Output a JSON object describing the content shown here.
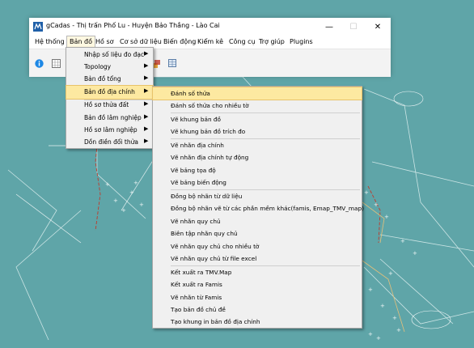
{
  "window": {
    "title": "gCadas - Thị trấn Phố Lu - Huyện Bảo Thắng - Lào Cai",
    "minimize_glyph": "—",
    "maximize_glyph": "☐",
    "close_glyph": "✕"
  },
  "menubar": {
    "items": [
      "Hệ thống",
      "Bản đồ",
      "Hồ sơ",
      "Cơ sở dữ liệu",
      "Biến động",
      "Kiểm kê",
      "Công cụ",
      "Trợ giúp",
      "Plugins"
    ],
    "active": "Bản đồ"
  },
  "toolbar": {
    "icons": [
      "info-icon",
      "grid-icon",
      "map-layers-icon",
      "table-icon"
    ]
  },
  "dropdown": {
    "arrow_glyph": "▶",
    "items": [
      {
        "label": "Nhập số liệu đo đạc",
        "has_submenu": true
      },
      {
        "label": "Topology",
        "has_submenu": true
      },
      {
        "label": "Bản đồ tổng",
        "has_submenu": true
      },
      {
        "label": "Bản đồ địa chính",
        "has_submenu": true,
        "highlighted": true
      },
      {
        "label": "Hồ sơ thửa đất",
        "has_submenu": true
      },
      {
        "label": "Bản đồ lâm nghiệp",
        "has_submenu": true
      },
      {
        "label": "Hồ sơ lâm nghiệp",
        "has_submenu": true
      },
      {
        "label": "Dồn điền đổi thửa",
        "has_submenu": true
      }
    ]
  },
  "submenu": {
    "items": [
      "Đánh số thửa",
      "Đánh số thửa cho nhiều tờ",
      "Vẽ khung bản đồ",
      "Vẽ khung bản đồ trích đo",
      "Vẽ nhãn địa chính",
      "Vẽ nhãn địa chính tự động",
      "Vẽ bảng tọa độ",
      "Vẽ bảng biến động",
      "Đồng bộ nhãn từ dữ liệu",
      "Đồng bộ nhãn vẽ từ các phần mềm khác(famis, Emap_TMV_map)",
      "Vẽ nhãn quy chủ",
      "Biên tập nhãn quy chủ",
      "Vẽ nhãn quy chủ cho nhiều tờ",
      "Vẽ nhãn quy chủ từ file excel",
      "Kết xuất ra TMV.Map",
      "Kết xuất ra Famis",
      "Vẽ nhãn từ Famis",
      "Tạo bản đồ chủ đề",
      "Tạo khung in bản đồ địa chính"
    ],
    "highlighted": "Đánh số thửa"
  },
  "colors": {
    "map_background": "#5fa5a8",
    "highlight": "#fde9a1",
    "parcel_line": "#c0392b",
    "plus_marks": "#ffffff"
  }
}
